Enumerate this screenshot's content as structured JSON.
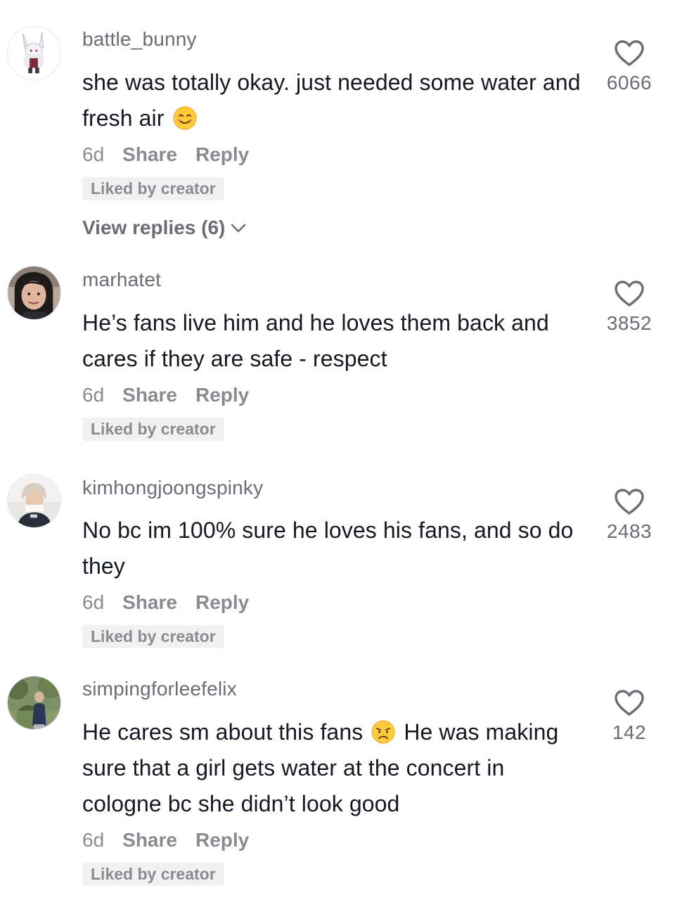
{
  "comments": [
    {
      "username": "battle_bunny",
      "text_before": "she was totally okay. just needed some water and fresh air",
      "text_after": "",
      "emoji": "smiling-face-emoji",
      "age": "6d",
      "share_label": "Share",
      "reply_label": "Reply",
      "badge": "Liked by creator",
      "view_replies": "View replies (6)",
      "likes": "6066",
      "avatar": "anime-bunny-avatar"
    },
    {
      "username": "marhatet",
      "text_before": "He’s fans live him and he loves them back and cares if they are safe - respect",
      "text_after": "",
      "emoji": "",
      "age": "6d",
      "share_label": "Share",
      "reply_label": "Reply",
      "badge": "Liked by creator",
      "likes": "3852",
      "avatar": "woman-photo-avatar"
    },
    {
      "username": "kimhongjoongspinky",
      "text_before": "No bc im 100% sure he loves his fans, and so do they",
      "text_after": "",
      "emoji": "",
      "age": "6d",
      "share_label": "Share",
      "reply_label": "Reply",
      "badge": "Liked by creator",
      "likes": "2483",
      "avatar": "person-photo-avatar"
    },
    {
      "username": "simpingforleefelix",
      "text_before": "He cares sm about this fans",
      "text_after": "He was making sure that a girl gets water at the concert in cologne bc she didn’t look good",
      "emoji": "disappointed-face-emoji",
      "age": "6d",
      "share_label": "Share",
      "reply_label": "Reply",
      "badge": "Liked by creator",
      "likes": "142",
      "avatar": "outdoor-photo-avatar"
    }
  ],
  "colors": {
    "text": "#161823",
    "secondary": "#8a8b91",
    "username": "#6b6d75",
    "badge_bg": "#f1f1f2"
  }
}
